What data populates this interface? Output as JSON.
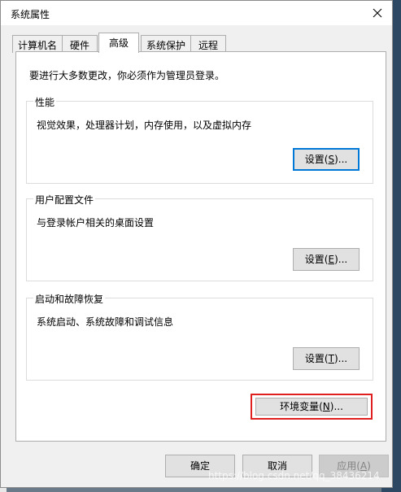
{
  "window": {
    "title": "系统属性"
  },
  "tabs": [
    {
      "label": "计算机名"
    },
    {
      "label": "硬件"
    },
    {
      "label": "高级"
    },
    {
      "label": "系统保护"
    },
    {
      "label": "远程"
    }
  ],
  "notice": "要进行大多数更改，你必须作为管理员登录。",
  "performance": {
    "title": "性能",
    "desc": "视觉效果，处理器计划，内存使用，以及虚拟内存",
    "btn_pre": "设置(",
    "btn_mn": "S",
    "btn_post": ")..."
  },
  "profile": {
    "title": "用户配置文件",
    "desc": "与登录帐户相关的桌面设置",
    "btn_pre": "设置(",
    "btn_mn": "E",
    "btn_post": ")..."
  },
  "startup": {
    "title": "启动和故障恢复",
    "desc": "系统启动、系统故障和调试信息",
    "btn_pre": "设置(",
    "btn_mn": "T",
    "btn_post": ")..."
  },
  "env": {
    "btn_pre": "环境变量(",
    "btn_mn": "N",
    "btn_post": ")..."
  },
  "footer": {
    "ok": "确定",
    "cancel": "取消",
    "apply_pre": "应用(",
    "apply_mn": "A",
    "apply_post": ")"
  },
  "watermark": "https://blog.csdn.net/qq_38436214",
  "accent_color": "#0078d7",
  "highlight_color": "#e02020"
}
